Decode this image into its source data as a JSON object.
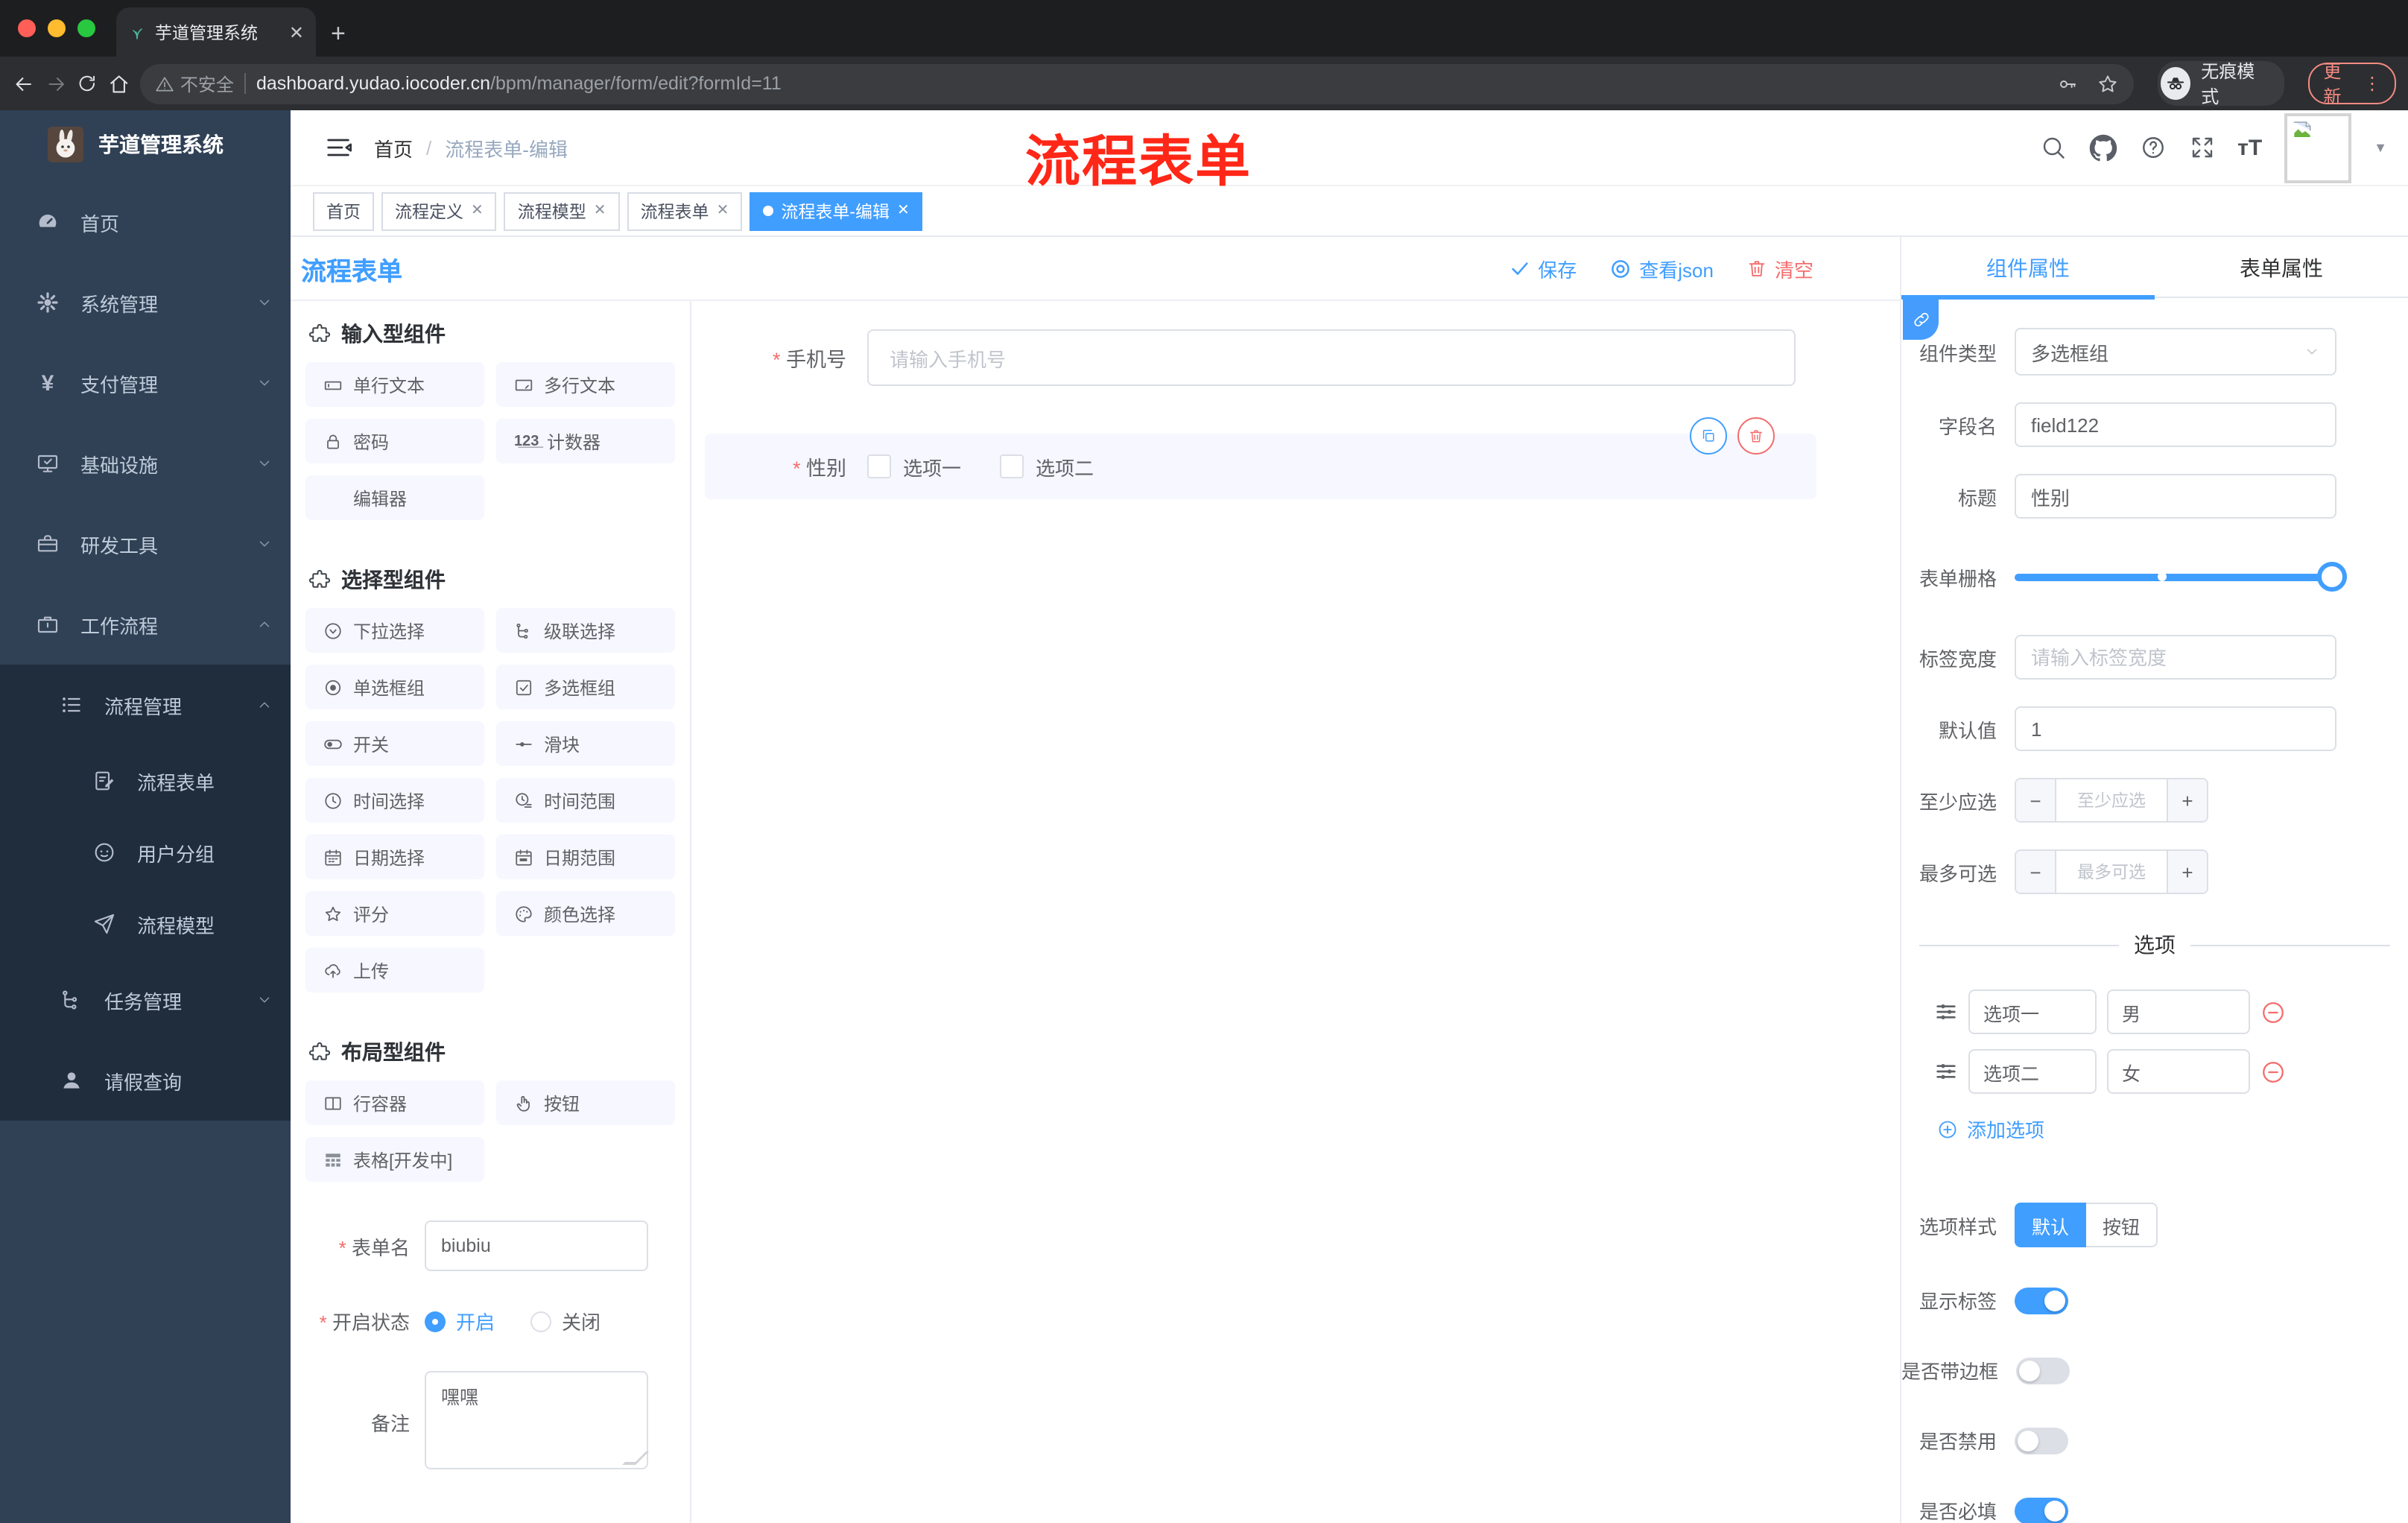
{
  "browser": {
    "tab_title": "芋道管理系统",
    "not_secure": "不安全",
    "url_host": "dashboard.yudao.iocoder.cn",
    "url_path": "/bpm/manager/form/edit?formId=11",
    "incognito_label": "无痕模式",
    "update_label": "更新"
  },
  "sidebar": {
    "logo_title": "芋道管理系统",
    "menu": [
      {
        "label": "首页"
      },
      {
        "label": "系统管理"
      },
      {
        "label": "支付管理"
      },
      {
        "label": "基础设施"
      },
      {
        "label": "研发工具"
      },
      {
        "label": "工作流程"
      }
    ],
    "submenu": [
      {
        "label": "流程管理"
      },
      {
        "label": "流程表单"
      },
      {
        "label": "用户分组"
      },
      {
        "label": "流程模型"
      },
      {
        "label": "任务管理"
      },
      {
        "label": "请假查询"
      }
    ]
  },
  "navbar": {
    "breadcrumb_home": "首页",
    "breadcrumb_current": "流程表单-编辑",
    "annotation": "流程表单"
  },
  "tags": {
    "items": [
      {
        "label": "首页"
      },
      {
        "label": "流程定义"
      },
      {
        "label": "流程模型"
      },
      {
        "label": "流程表单"
      },
      {
        "label": "流程表单-编辑"
      }
    ]
  },
  "designer": {
    "title": "流程表单",
    "save_label": "保存",
    "view_json_label": "查看json",
    "clear_label": "清空"
  },
  "palette": {
    "sections": [
      {
        "title": "输入型组件",
        "items": [
          {
            "label": "单行文本"
          },
          {
            "label": "多行文本"
          },
          {
            "label": "密码"
          },
          {
            "label": "计数器"
          },
          {
            "label": "编辑器"
          }
        ]
      },
      {
        "title": "选择型组件",
        "items": [
          {
            "label": "下拉选择"
          },
          {
            "label": "级联选择"
          },
          {
            "label": "单选框组"
          },
          {
            "label": "多选框组"
          },
          {
            "label": "开关"
          },
          {
            "label": "滑块"
          },
          {
            "label": "时间选择"
          },
          {
            "label": "时间范围"
          },
          {
            "label": "日期选择"
          },
          {
            "label": "日期范围"
          },
          {
            "label": "评分"
          },
          {
            "label": "颜色选择"
          },
          {
            "label": "上传"
          }
        ]
      },
      {
        "title": "布局型组件",
        "items": [
          {
            "label": "行容器"
          },
          {
            "label": "按钮"
          },
          {
            "label": "表格[开发中]"
          }
        ]
      }
    ]
  },
  "form_meta": {
    "name_label": "表单名",
    "name_value": "biubiu",
    "status_label": "开启状态",
    "status_on": "开启",
    "status_off": "关闭",
    "remark_label": "备注",
    "remark_value": "嘿嘿"
  },
  "canvas": {
    "phone_label": "手机号",
    "phone_placeholder": "请输入手机号",
    "gender_label": "性别",
    "gender_opt1": "选项一",
    "gender_opt2": "选项二"
  },
  "props": {
    "tab_component": "组件属性",
    "tab_form": "表单属性",
    "type_label": "组件类型",
    "type_value": "多选框组",
    "field_label": "字段名",
    "field_value": "field122",
    "title_label": "标题",
    "title_value": "性别",
    "grid_label": "表单栅格",
    "label_width_label": "标签宽度",
    "label_width_placeholder": "请输入标签宽度",
    "default_label": "默认值",
    "default_value": "1",
    "min_label": "至少应选",
    "min_placeholder": "至少应选",
    "max_label": "最多可选",
    "max_placeholder": "最多可选",
    "options_title": "选项",
    "options": [
      {
        "label": "选项一",
        "value": "男"
      },
      {
        "label": "选项二",
        "value": "女"
      }
    ],
    "add_option": "添加选项",
    "style_label": "选项样式",
    "style_default": "默认",
    "style_button": "按钮",
    "toggle_show_label": "显示标签",
    "toggle_border_label": "是否带边框",
    "toggle_disabled_label": "是否禁用",
    "toggle_required_label": "是否必填"
  },
  "icons": {
    "save": "check",
    "view_json": "concentric-circles",
    "clear": "trash",
    "copy": "copy",
    "delete": "trash",
    "add_option": "plus-circle",
    "remove_option": "minus-circle",
    "incognito": "incognito-mask",
    "avatar": "broken-image"
  },
  "colors": {
    "accent": "#409eff",
    "danger": "#f56c6c",
    "annotation_red": "#ff2717",
    "sidebar_bg": "#304156",
    "submenu_bg": "#1f2d3d",
    "palette_item_bg": "#f6f7ff",
    "selected_block_bg": "#f6f7ff",
    "chrome_dark": "#1d1e20",
    "toolbar_dark": "#2d2e31"
  }
}
